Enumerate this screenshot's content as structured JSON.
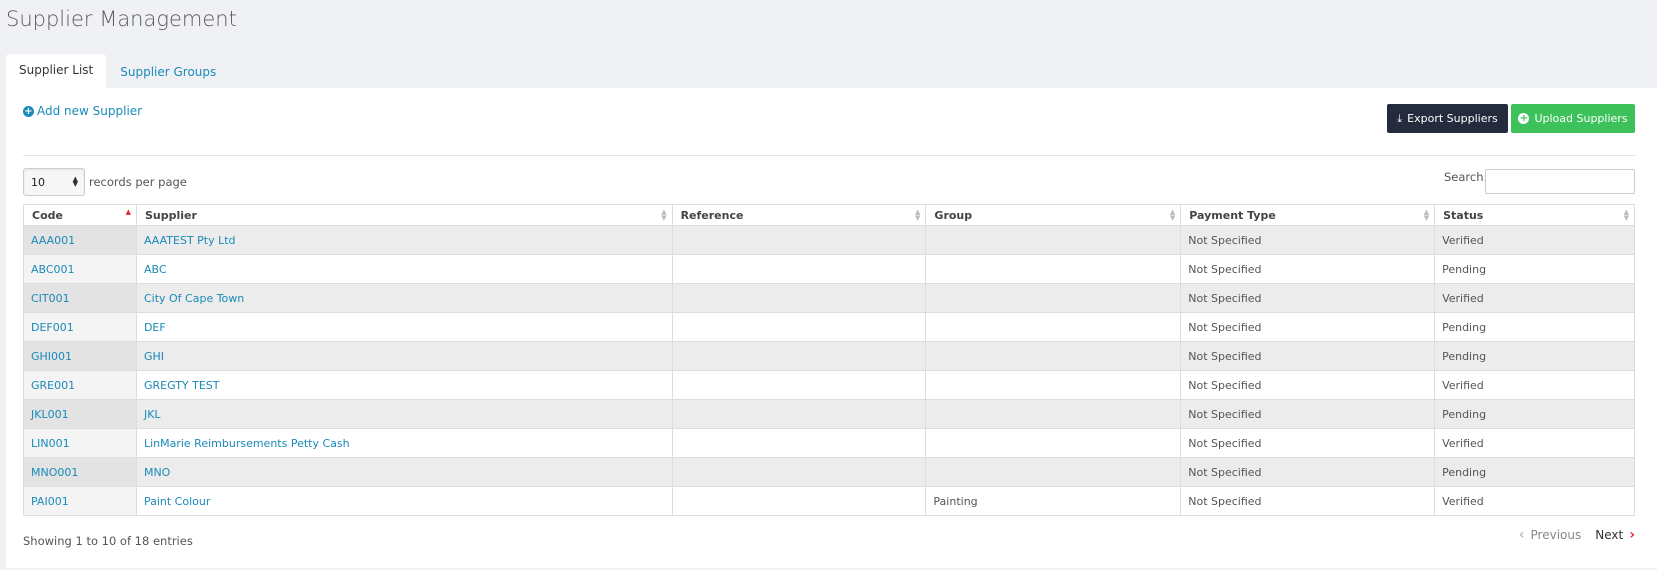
{
  "page": {
    "title": "Supplier Management"
  },
  "tabs": [
    {
      "label": "Supplier List"
    },
    {
      "label": "Supplier Groups"
    }
  ],
  "actions": {
    "add_label": "Add new Supplier",
    "export_label": "Export Suppliers",
    "upload_label": "Upload Suppliers"
  },
  "length": {
    "value": "10",
    "label": "records per page"
  },
  "search": {
    "label": "Search:",
    "value": ""
  },
  "table": {
    "headers": [
      "Code",
      "Supplier",
      "Reference",
      "Group",
      "Payment Type",
      "Status"
    ],
    "rows": [
      {
        "code": "AAA001",
        "supplier": "AAATEST Pty Ltd",
        "reference": "",
        "group": "",
        "payment": "Not Specified",
        "status": "Verified"
      },
      {
        "code": "ABC001",
        "supplier": "ABC",
        "reference": "",
        "group": "",
        "payment": "Not Specified",
        "status": "Pending"
      },
      {
        "code": "CIT001",
        "supplier": "City Of Cape Town",
        "reference": "",
        "group": "",
        "payment": "Not Specified",
        "status": "Verified"
      },
      {
        "code": "DEF001",
        "supplier": "DEF",
        "reference": "",
        "group": "",
        "payment": "Not Specified",
        "status": "Pending"
      },
      {
        "code": "GHI001",
        "supplier": "GHI",
        "reference": "",
        "group": "",
        "payment": "Not Specified",
        "status": "Pending"
      },
      {
        "code": "GRE001",
        "supplier": "GREGTY TEST",
        "reference": "",
        "group": "",
        "payment": "Not Specified",
        "status": "Verified"
      },
      {
        "code": "JKL001",
        "supplier": "JKL",
        "reference": "",
        "group": "",
        "payment": "Not Specified",
        "status": "Pending"
      },
      {
        "code": "LIN001",
        "supplier": "LinMarie Reimbursements Petty Cash",
        "reference": "",
        "group": "",
        "payment": "Not Specified",
        "status": "Verified"
      },
      {
        "code": "MNO001",
        "supplier": "MNO",
        "reference": "",
        "group": "",
        "payment": "Not Specified",
        "status": "Pending"
      },
      {
        "code": "PAI001",
        "supplier": "Paint Colour",
        "reference": "",
        "group": "Painting",
        "payment": "Not Specified",
        "status": "Verified"
      }
    ]
  },
  "footer": {
    "info": "Showing 1 to 10 of 18 entries",
    "previous": "Previous",
    "next": "Next"
  },
  "colors": {
    "link": "#1a8ab8",
    "export_button": "#232b3d",
    "upload_button": "#3dc15b",
    "sort_active": "#ee2233"
  }
}
